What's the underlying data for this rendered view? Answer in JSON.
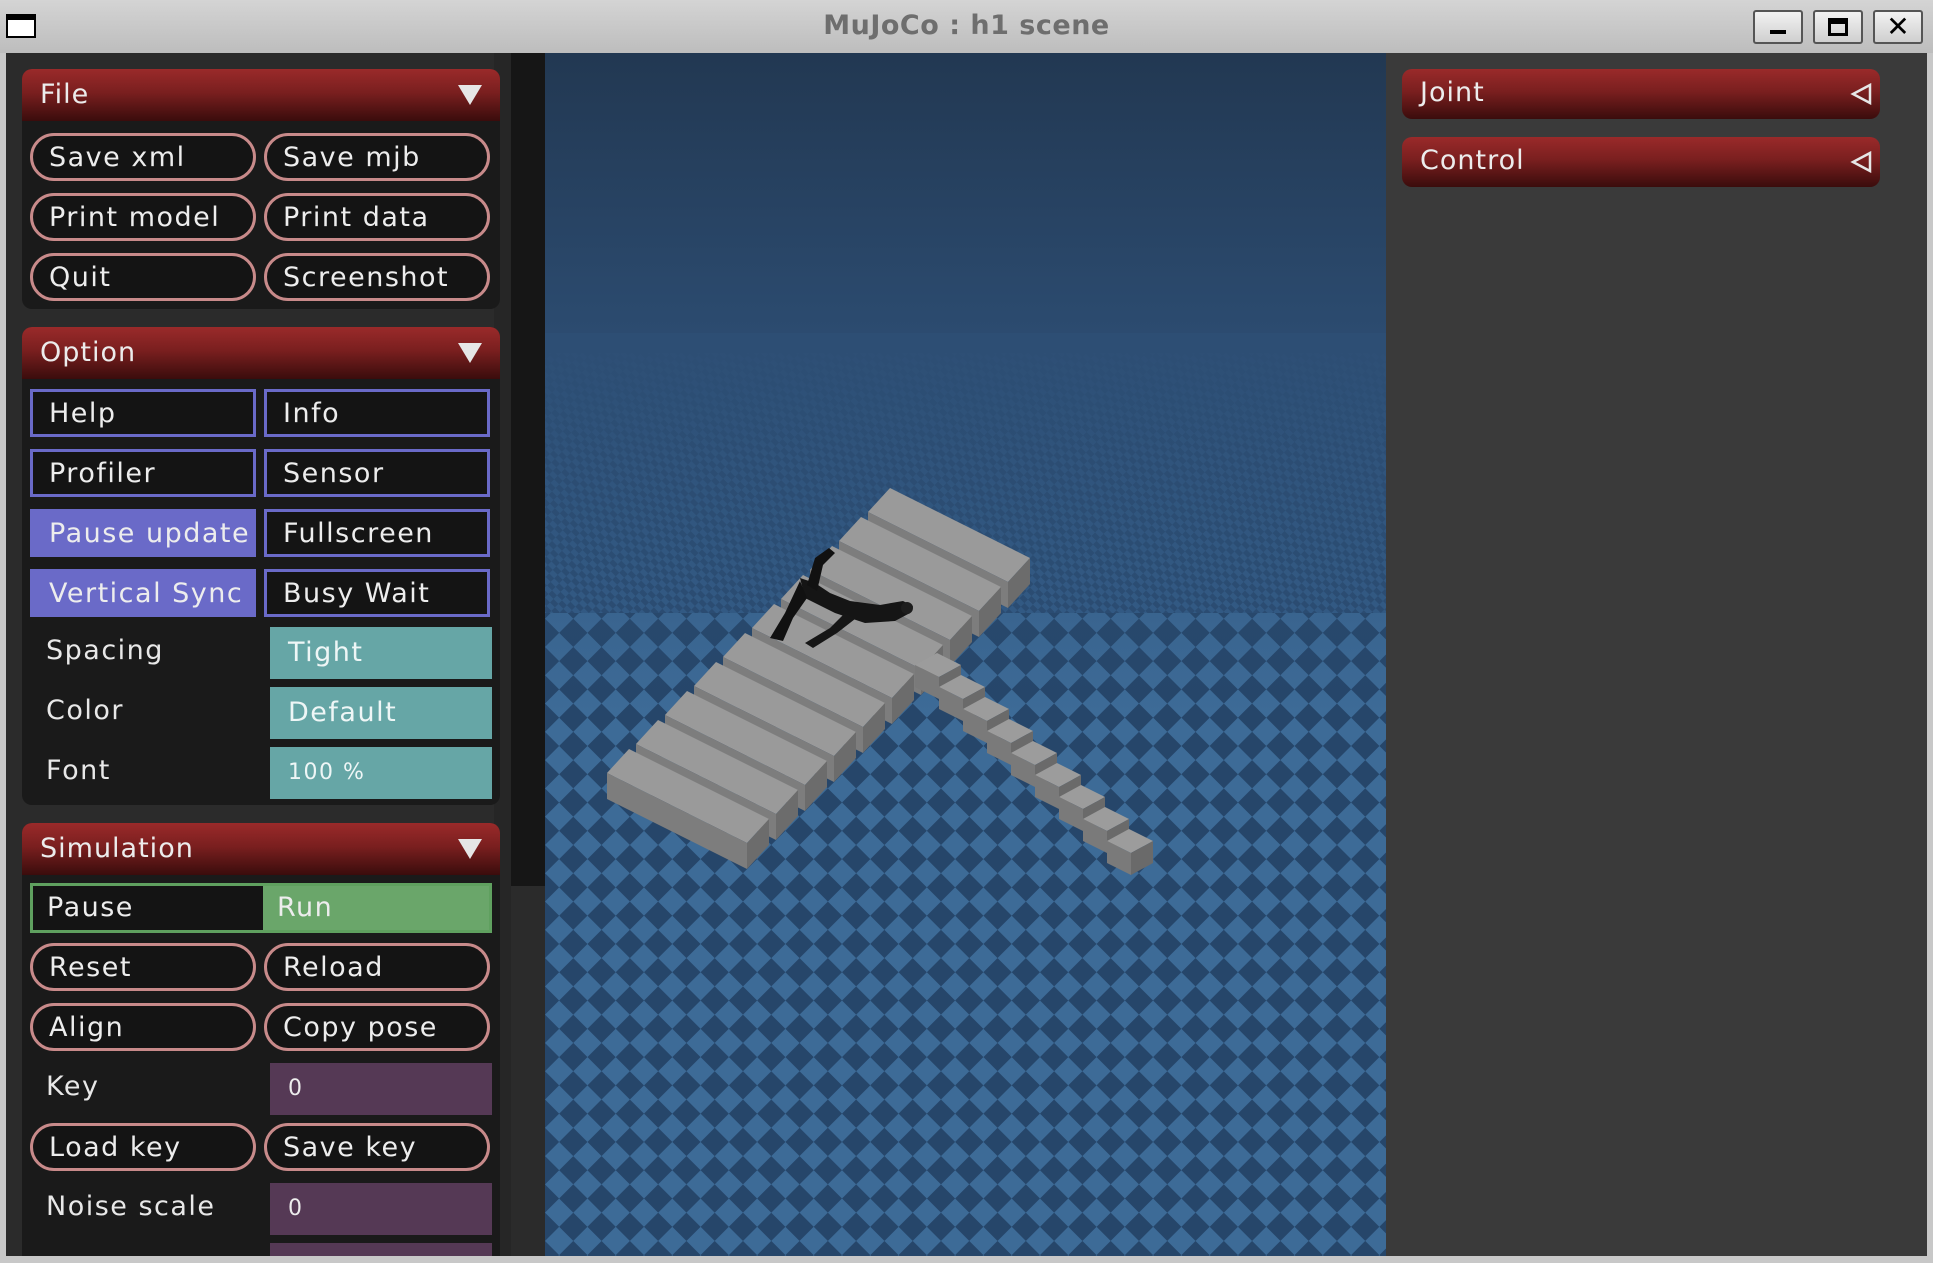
{
  "window": {
    "title": "MuJoCo : h1 scene"
  },
  "left_panel": {
    "file": {
      "title": "File",
      "buttons": [
        "Save xml",
        "Save mjb",
        "Print model",
        "Print data",
        "Quit",
        "Screenshot"
      ]
    },
    "option": {
      "title": "Option",
      "toggles": [
        {
          "label": "Help",
          "on": false
        },
        {
          "label": "Info",
          "on": false
        },
        {
          "label": "Profiler",
          "on": false
        },
        {
          "label": "Sensor",
          "on": false
        },
        {
          "label": "Pause update",
          "on": true
        },
        {
          "label": "Fullscreen",
          "on": false
        },
        {
          "label": "Vertical Sync",
          "on": true
        },
        {
          "label": "Busy Wait",
          "on": false
        }
      ],
      "spacing": {
        "label": "Spacing",
        "value": "Tight"
      },
      "color": {
        "label": "Color",
        "value": "Default"
      },
      "font": {
        "label": "Font",
        "value": "100 %"
      }
    },
    "simulation": {
      "title": "Simulation",
      "run_mode": {
        "options": [
          "Pause",
          "Run"
        ],
        "selected": "Run"
      },
      "buttons": [
        "Reset",
        "Reload",
        "Align",
        "Copy pose"
      ],
      "key": {
        "label": "Key",
        "value": "0"
      },
      "key_buttons": [
        "Load key",
        "Save key"
      ],
      "noise_scale": {
        "label": "Noise scale",
        "value": "0"
      }
    }
  },
  "right_panel": {
    "sections": [
      {
        "title": "Joint",
        "collapsed": true
      },
      {
        "title": "Control",
        "collapsed": true
      }
    ]
  },
  "colors": {
    "header_red": "#8b2424",
    "toggle_blue": "#6a6ac8",
    "select_teal": "#66a6a6",
    "edit_purple": "#553955",
    "run_green": "#6aa66a",
    "floor_blue": "#2e5a86"
  }
}
